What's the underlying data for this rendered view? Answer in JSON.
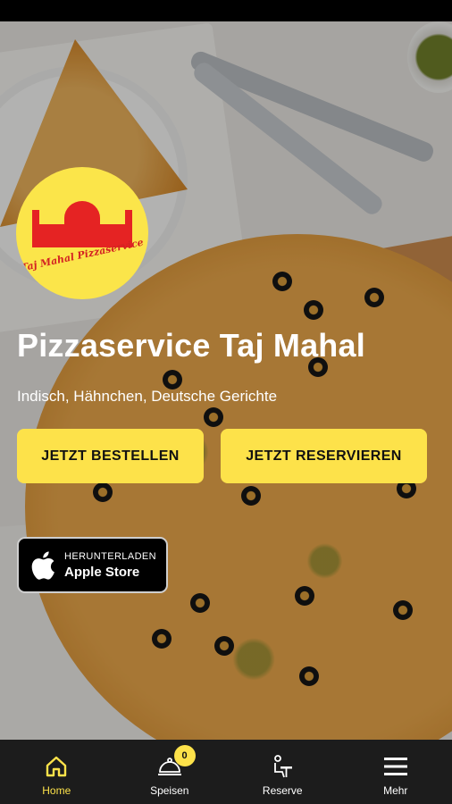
{
  "restaurant": {
    "name": "Pizzaservice Taj Mahal",
    "cuisine": "Indisch, Hähnchen, Deutsche Gerichte",
    "logo_text": "Taj Mahal Pizzaservice"
  },
  "actions": {
    "order_label": "JETZT BESTELLEN",
    "reserve_label": "JETZT RESERVIEREN"
  },
  "store_badge": {
    "small_text": "HERUNTERLADEN",
    "big_text": "Apple Store",
    "icon": "apple-icon"
  },
  "tabbar": {
    "items": [
      {
        "label": "Home",
        "icon": "home-icon",
        "active": true
      },
      {
        "label": "Speisen",
        "icon": "cloche-icon",
        "badge": "0"
      },
      {
        "label": "Reserve",
        "icon": "reserve-icon"
      },
      {
        "label": "Mehr",
        "icon": "menu-icon"
      }
    ]
  },
  "colors": {
    "accent": "#fde24a",
    "tabbar_bg": "#1c1c1c",
    "logo_red": "#e52323"
  }
}
